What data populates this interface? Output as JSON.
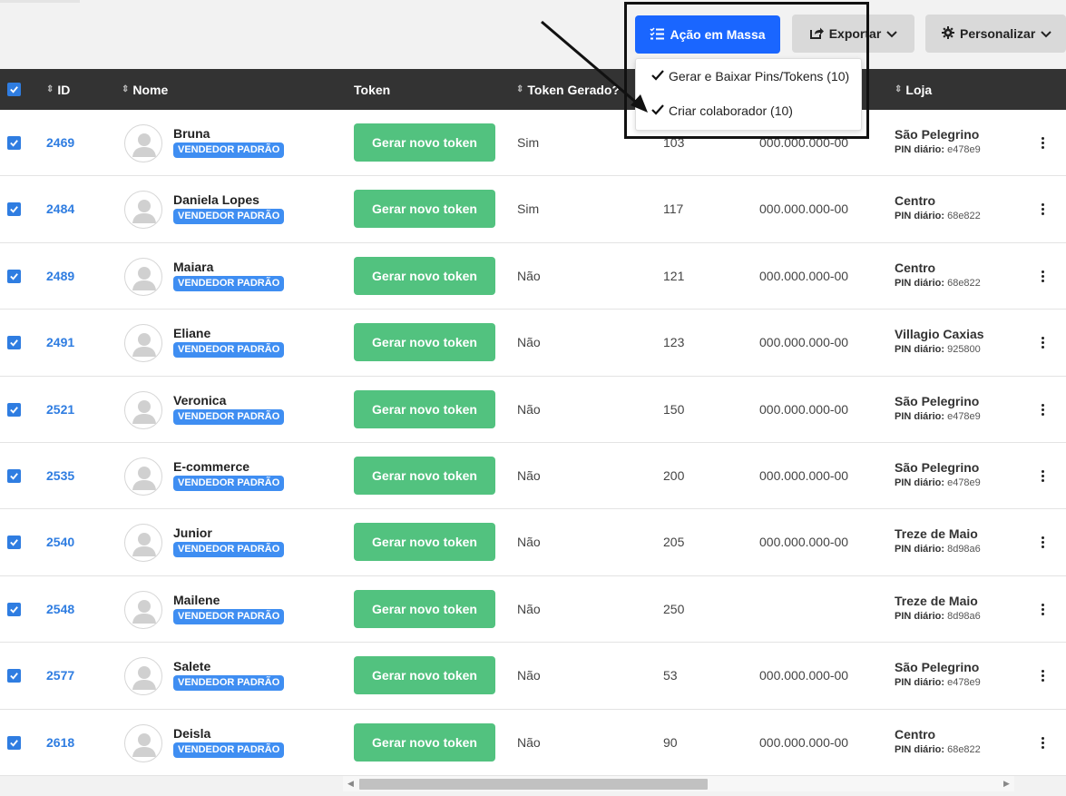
{
  "toolbar": {
    "mass_action_label": "Ação em Massa",
    "export_label": "Exportar",
    "customize_label": "Personalizar"
  },
  "dropdown": {
    "items": [
      {
        "label": "Gerar e Baixar Pins/Tokens (10)"
      },
      {
        "label": "Criar colaborador (10)"
      }
    ]
  },
  "table": {
    "headers": {
      "id": "ID",
      "nome": "Nome",
      "token": "Token",
      "token_gerado": "Token Gerado?",
      "loja": "Loja"
    },
    "token_button_label": "Gerar novo token",
    "role_badge": "VENDEDOR PADRÃO",
    "pin_label": "PIN diário:",
    "rows": [
      {
        "id": "2469",
        "nome": "Bruna",
        "token_gerado": "Sim",
        "numero": "103",
        "cpf": "000.000.000-00",
        "loja": "São Pelegrino",
        "pin": "e478e9"
      },
      {
        "id": "2484",
        "nome": "Daniela Lopes",
        "token_gerado": "Sim",
        "numero": "117",
        "cpf": "000.000.000-00",
        "loja": "Centro",
        "pin": "68e822"
      },
      {
        "id": "2489",
        "nome": "Maiara",
        "token_gerado": "Não",
        "numero": "121",
        "cpf": "000.000.000-00",
        "loja": "Centro",
        "pin": "68e822"
      },
      {
        "id": "2491",
        "nome": "Eliane",
        "token_gerado": "Não",
        "numero": "123",
        "cpf": "000.000.000-00",
        "loja": "Villagio Caxias",
        "pin": "925800"
      },
      {
        "id": "2521",
        "nome": "Veronica",
        "token_gerado": "Não",
        "numero": "150",
        "cpf": "000.000.000-00",
        "loja": "São Pelegrino",
        "pin": "e478e9"
      },
      {
        "id": "2535",
        "nome": "E-commerce",
        "token_gerado": "Não",
        "numero": "200",
        "cpf": "000.000.000-00",
        "loja": "São Pelegrino",
        "pin": "e478e9"
      },
      {
        "id": "2540",
        "nome": "Junior",
        "token_gerado": "Não",
        "numero": "205",
        "cpf": "000.000.000-00",
        "loja": "Treze de Maio",
        "pin": "8d98a6"
      },
      {
        "id": "2548",
        "nome": "Mailene",
        "token_gerado": "Não",
        "numero": "250",
        "cpf": "",
        "loja": "Treze de Maio",
        "pin": "8d98a6"
      },
      {
        "id": "2577",
        "nome": "Salete",
        "token_gerado": "Não",
        "numero": "53",
        "cpf": "000.000.000-00",
        "loja": "São Pelegrino",
        "pin": "e478e9"
      },
      {
        "id": "2618",
        "nome": "Deisla",
        "token_gerado": "Não",
        "numero": "90",
        "cpf": "000.000.000-00",
        "loja": "Centro",
        "pin": "68e822"
      }
    ]
  },
  "colors": {
    "primary": "#1a66ff",
    "link": "#2f7de1",
    "token_button": "#52c27f",
    "badge": "#3f8ef2",
    "header_bg": "#333333"
  },
  "icons": [
    "list-check-icon",
    "share-icon",
    "chevron-down-icon",
    "gear-icon",
    "check-icon",
    "sort-icon",
    "kebab-menu-icon",
    "avatar-icon"
  ]
}
